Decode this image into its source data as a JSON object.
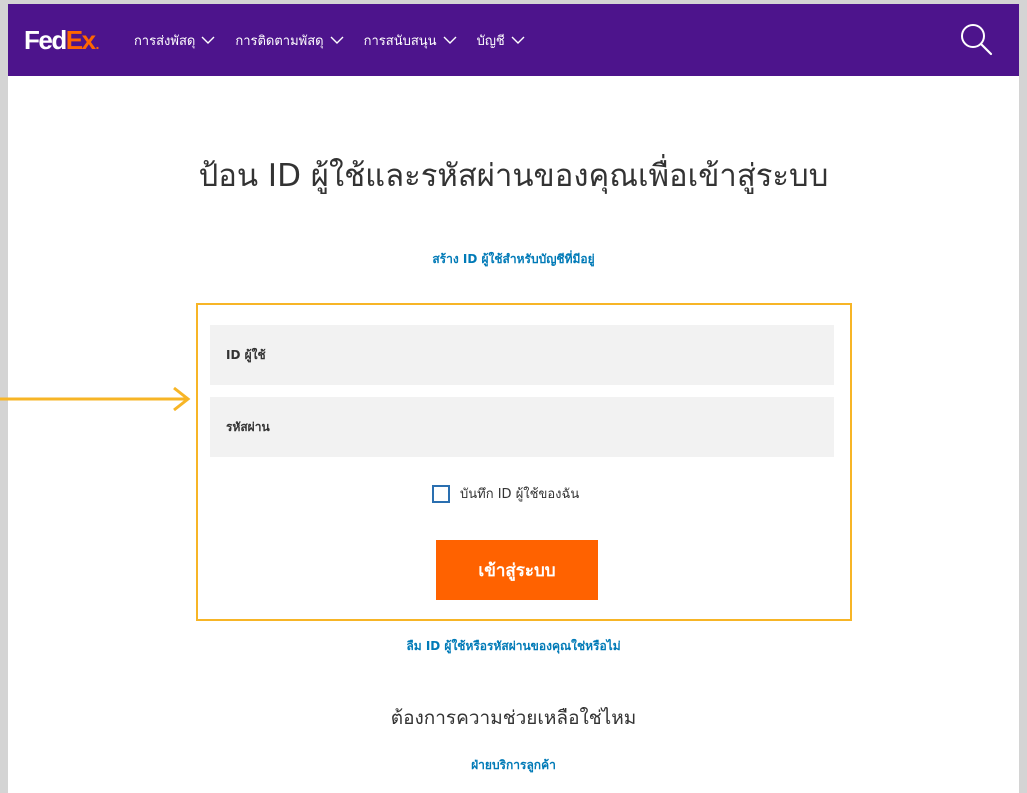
{
  "header": {
    "logo_fed": "Fed",
    "logo_ex": "Ex",
    "logo_dot": ".",
    "nav": [
      {
        "label": "การส่งพัสดุ"
      },
      {
        "label": "การติดตามพัสดุ"
      },
      {
        "label": "การสนับสนุน"
      },
      {
        "label": "บัญชี"
      }
    ],
    "brand_color": "#4d148c",
    "accent_color": "#ff6600"
  },
  "main": {
    "title": "ป้อน ID ผู้ใช้และรหัสผ่านของคุณเพื่อเข้าสู่ระบบ",
    "create_id_link": "สร้าง ID ผู้ใช้สำหรับบัญชีที่มีอยู่",
    "form": {
      "user_id_placeholder": "ID ผู้ใช้",
      "password_placeholder": "รหัสผ่าน",
      "remember_label": "บันทึก ID ผู้ใช้ของฉัน",
      "remember_checked": false,
      "login_button": "เข้าสู่ระบบ"
    },
    "forgot_link": "ลืม ID ผู้ใช้หรือรหัสผ่านของคุณใช่หรือไม่",
    "help_heading": "ต้องการความช่วยเหลือใช่ไหม",
    "support_link": "ฝ่ายบริการลูกค้า"
  },
  "annotation": {
    "arrow_color": "#f7b526",
    "highlight_color": "#f7b526"
  }
}
